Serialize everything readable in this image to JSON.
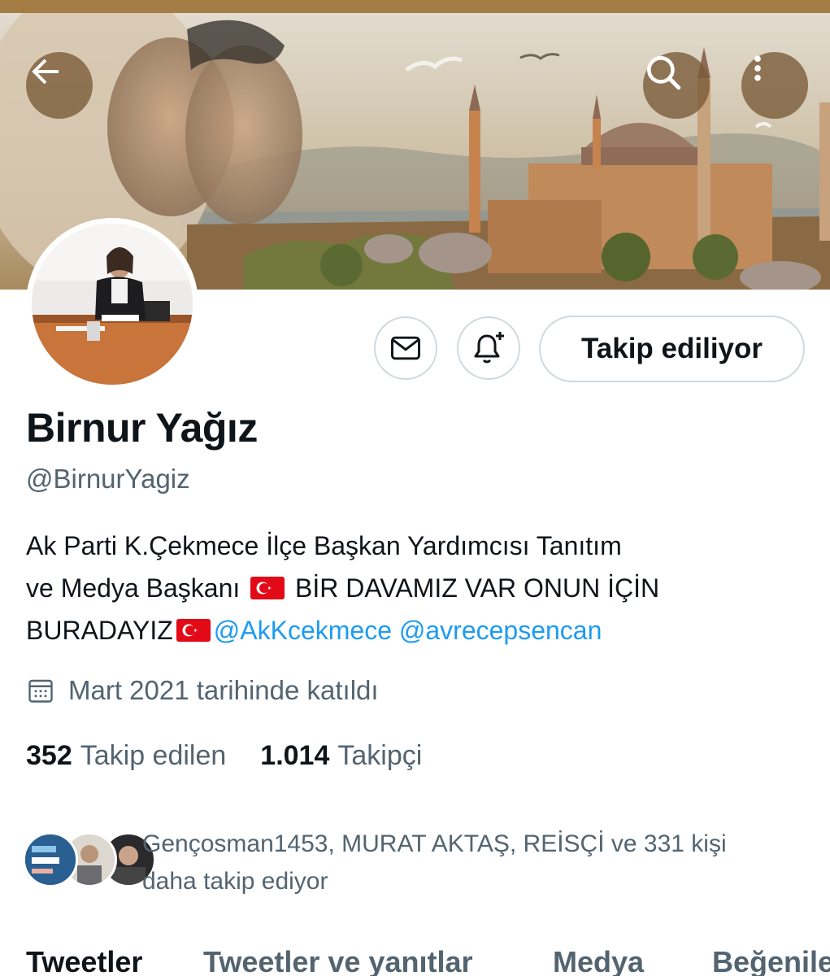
{
  "header": {
    "back_icon": "arrow-left-icon",
    "search_icon": "search-icon",
    "more_icon": "more-vertical-icon"
  },
  "profile": {
    "name": "Birnur Yağız",
    "handle": "@BirnurYagiz",
    "bio_line1": "Ak Parti K.Çekmece İlçe Başkan Yardımcısı Tanıtım",
    "bio_line2a": "ve Medya Başkanı",
    "bio_line2b": "BİR DAVAMIZ VAR ONUN İÇİN",
    "bio_line3a": "BURADAYIZ",
    "bio_mention1": "@AkKcekmece",
    "bio_mention2": "@avrecepsencan",
    "joined": "Mart 2021 tarihinde katıldı"
  },
  "actions": {
    "message_icon": "mail-icon",
    "notify_icon": "bell-plus-icon",
    "follow_label": "Takip ediliyor"
  },
  "stats": {
    "following_count": "352",
    "following_label": "Takip edilen",
    "followers_count": "1.014",
    "followers_label": "Takipçi"
  },
  "followed_by": {
    "line1": "Gençosman1453, MURAT AKTAŞ, REİSÇİ ve 331 kişi",
    "line2": "daha takip ediyor"
  },
  "tabs": [
    {
      "label": "Tweetler"
    },
    {
      "label": "Tweetler ve yanıtlar"
    },
    {
      "label": "Medya"
    },
    {
      "label": "Beğeniler"
    }
  ],
  "colors": {
    "link": "#1d9bf0",
    "secondary_text": "#536471",
    "border": "#cfd9de",
    "flag_red": "#e30a17"
  }
}
